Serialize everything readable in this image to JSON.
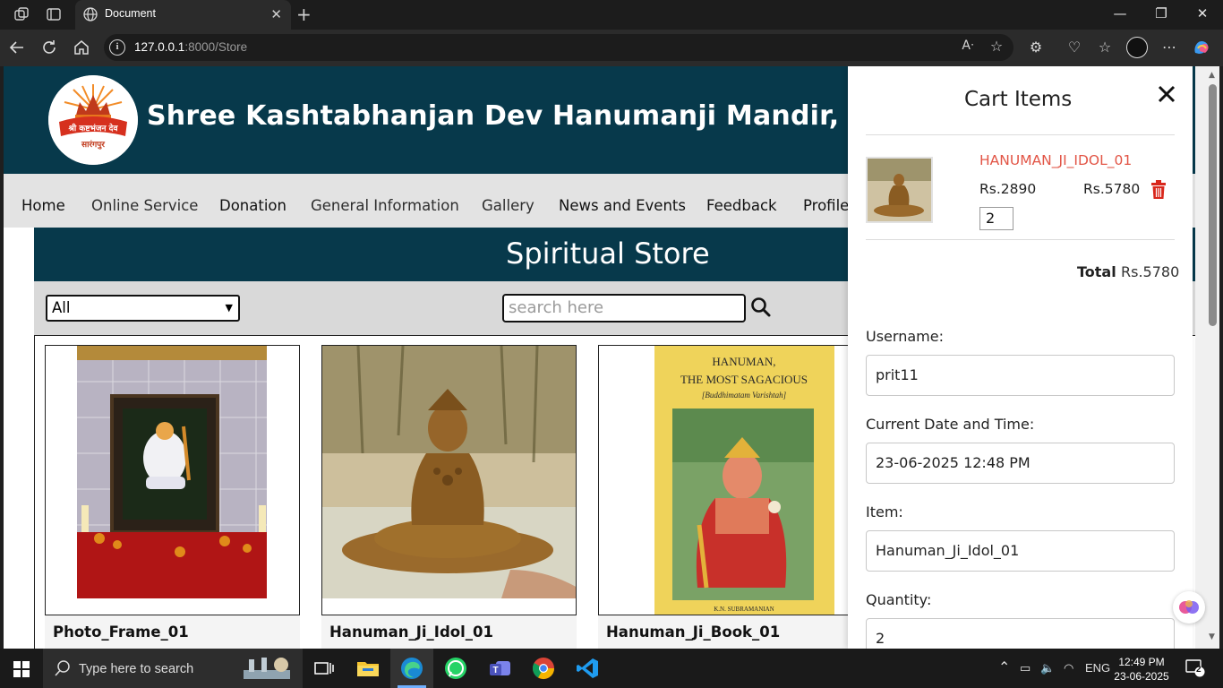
{
  "browser": {
    "tab_title": "Document",
    "url_host": "127.0.0.1",
    "url_rest": ":8000/Store"
  },
  "header": {
    "site_title": "Shree Kashtabhanjan Dev Hanumanji Mandir, Salangpur",
    "logo_text_top": "श्री कष्टभंजन देव",
    "logo_text_bottom": "सारंगपुर"
  },
  "nav": [
    "Home",
    "Online Service",
    "Donation",
    "General Information",
    "Gallery",
    "News and Events",
    "Feedback",
    "Profile"
  ],
  "store": {
    "title": "Spiritual Store",
    "category_selected": "All",
    "search_placeholder": "search here",
    "products": [
      {
        "name": "Photo_Frame_01"
      },
      {
        "name": "Hanuman_Ji_Idol_01"
      },
      {
        "name": "Hanuman_Ji_Book_01",
        "cover_title": "HANUMAN,",
        "cover_title2": "THE MOST SAGACIOUS",
        "cover_subtitle": "[Buddhimatam Varishtah]",
        "cover_author": "K.N. SUBRAMANIAN"
      }
    ]
  },
  "cart": {
    "title": "Cart Items",
    "item_name": "HANUMAN_JI_IDOL_01",
    "item_price": "Rs.2890",
    "item_subtotal": "Rs.5780",
    "item_qty": "2",
    "total_label": "Total",
    "total_value": "Rs.5780",
    "form": [
      {
        "label": "Username:",
        "value": "prit11"
      },
      {
        "label": "Current Date and Time:",
        "value": "23-06-2025 12:48  PM"
      },
      {
        "label": "Item:",
        "value": "Hanuman_Ji_Idol_01"
      },
      {
        "label": "Quantity:",
        "value": "2"
      }
    ]
  },
  "taskbar": {
    "search_placeholder": "Type here to search",
    "lang": "ENG",
    "time": "12:49 PM",
    "date": "23-06-2025",
    "notifications": "2"
  },
  "colors": {
    "header_bg": "#07394b",
    "cart_item_name": "#e25546",
    "trash_red": "#d9271c"
  }
}
